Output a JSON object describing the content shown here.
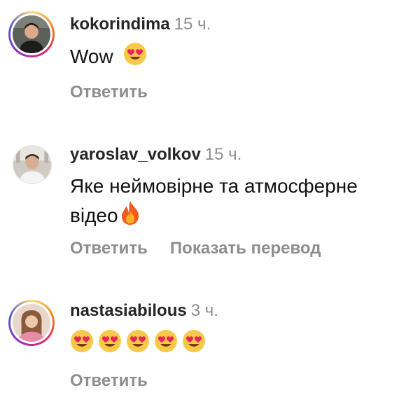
{
  "comments": [
    {
      "username": "kokorindima",
      "time": "15 ч.",
      "text": "Wow",
      "emoji": [
        "heart-eyes"
      ],
      "reply_label": "Ответить"
    },
    {
      "username": "yaroslav_volkov",
      "time": "15 ч.",
      "text_line1": "Яке неймовірне та атмосферне",
      "text_line2": "відео",
      "emoji": [
        "fire"
      ],
      "reply_label": "Ответить",
      "translate_label": "Показать перевод"
    },
    {
      "username": "nastasiabilous",
      "time": "3 ч.",
      "emoji": [
        "heart-eyes",
        "heart-eyes",
        "heart-eyes",
        "heart-eyes",
        "heart-eyes"
      ],
      "reply_label": "Ответить"
    }
  ],
  "colors": {
    "username": "#262626",
    "muted": "#8e8e8e",
    "text": "#111111"
  }
}
